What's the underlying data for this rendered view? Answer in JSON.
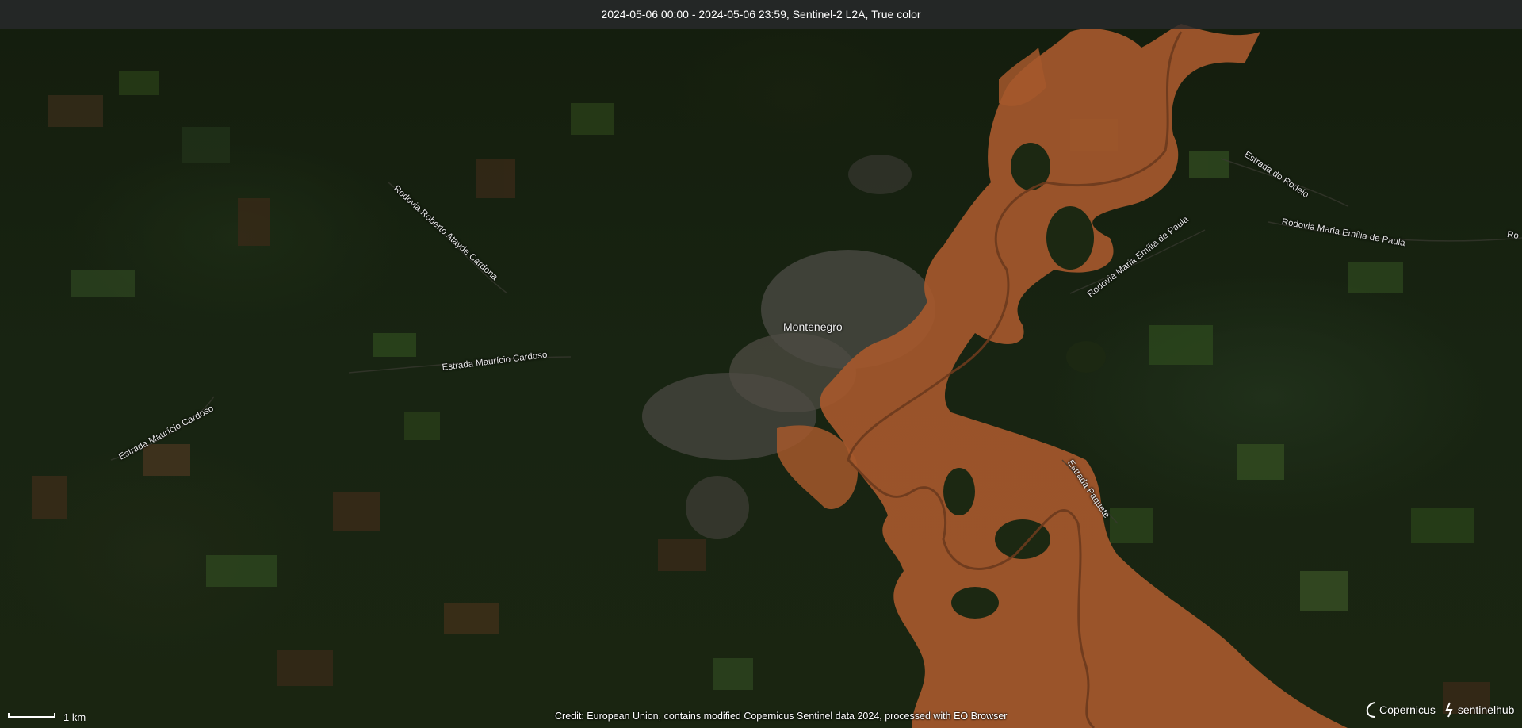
{
  "header": {
    "title": "2024-05-06 00:00 - 2024-05-06 23:59, Sentinel-2 L2A, True color"
  },
  "map": {
    "place_labels": [
      {
        "name": "montenegro",
        "text": "Montenegro"
      }
    ],
    "road_labels": [
      {
        "name": "rodovia-roberto-atayde-cardona",
        "text": "Rodovia Roberto Atayde Cardona"
      },
      {
        "name": "estrada-mauricio-cardoso-1",
        "text": "Estrada Maurício Cardoso"
      },
      {
        "name": "estrada-mauricio-cardoso-2",
        "text": "Estrada Maurício Cardoso"
      },
      {
        "name": "estrada-do-rodeio",
        "text": "Estrada do Rodeio"
      },
      {
        "name": "rodovia-maria-emilia-de-paula-1",
        "text": "Rodovia Maria Emília de Paula"
      },
      {
        "name": "rodovia-maria-emilia-de-paula-2",
        "text": "Rodovia Maria Emília de Paula"
      },
      {
        "name": "estrada-paquete",
        "text": "Estrada Paquete"
      },
      {
        "name": "ro-partial",
        "text": "Ro"
      }
    ],
    "colors": {
      "vegetation": "#1a2511",
      "floodwater": "#a5582c",
      "urban": "#55524a",
      "field_brown": "#4a3520",
      "field_green": "#2e4a1e"
    }
  },
  "footer": {
    "scale_label": "1 km",
    "credit": "Credit: European Union, contains modified Copernicus Sentinel data 2024, processed with EO Browser",
    "logo_copernicus": "Copernicus",
    "logo_sentinelhub": "sentinelhub"
  }
}
